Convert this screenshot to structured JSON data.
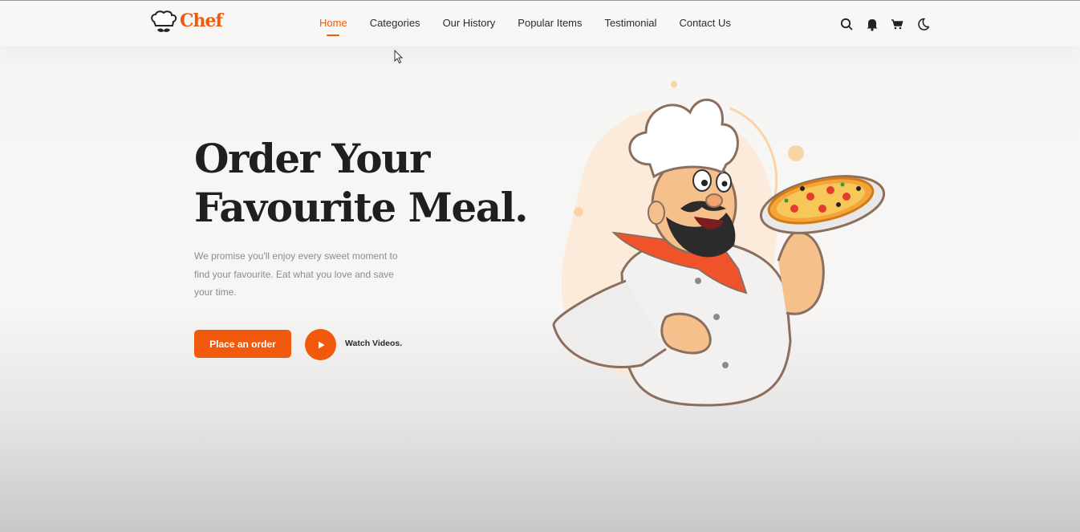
{
  "brand": {
    "name": "Chef",
    "accent": "#f15a0c"
  },
  "nav": {
    "items": [
      {
        "label": "Home",
        "active": true
      },
      {
        "label": "Categories"
      },
      {
        "label": "Our History"
      },
      {
        "label": "Popular Items"
      },
      {
        "label": "Testimonial"
      },
      {
        "label": "Contact Us"
      }
    ]
  },
  "header_icons": [
    "search-icon",
    "bell-icon",
    "cart-icon",
    "moon-icon"
  ],
  "hero": {
    "title_line1": "Order Your",
    "title_line2": "Favourite Meal.",
    "description": "We promise you'll enjoy every sweet moment to find your favourite. Eat what you love and save your time.",
    "order_button": "Place an order",
    "watch_label": "Watch Videos."
  }
}
